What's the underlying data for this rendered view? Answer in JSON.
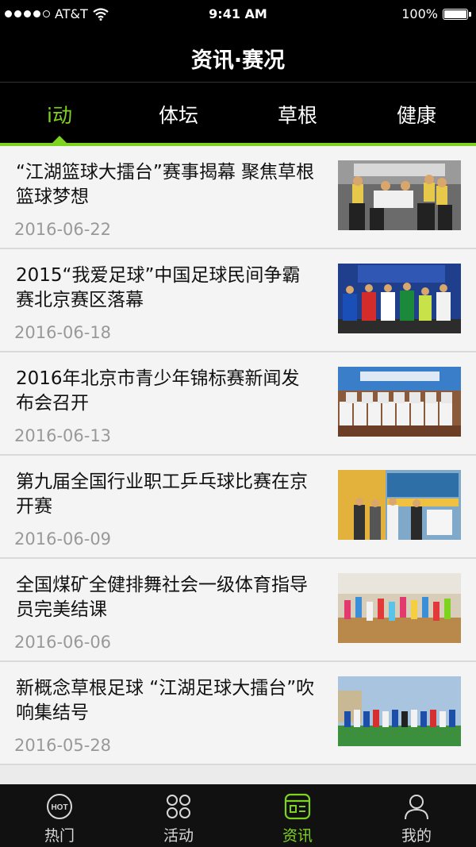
{
  "status_bar": {
    "carrier": "AT&T",
    "time": "9:41 AM",
    "battery": "100%"
  },
  "nav": {
    "title": "资讯·赛况"
  },
  "tabs": [
    {
      "label": "i动"
    },
    {
      "label": "体坛"
    },
    {
      "label": "草根"
    },
    {
      "label": "健康"
    }
  ],
  "news": [
    {
      "title": "“江湖篮球大擂台”赛事揭幕 聚焦草根篮球梦想",
      "date": "2016-06-22"
    },
    {
      "title": "2015“我爱足球”中国足球民间争霸赛北京赛区落幕",
      "date": "2016-06-18"
    },
    {
      "title": "2016年北京市青少年锦标赛新闻发布会召开",
      "date": "2016-06-13"
    },
    {
      "title": "第九届全国行业职工乒乓球比赛在京开赛",
      "date": "2016-06-09"
    },
    {
      "title": "全国煤矿全健排舞社会一级体育指导员完美结课",
      "date": "2016-06-06"
    },
    {
      "title": "新概念草根足球 “江湖足球大擂台”吹响集结号",
      "date": "2016-05-28"
    }
  ],
  "tabbar": [
    {
      "label": "热门",
      "icon": "hot-icon"
    },
    {
      "label": "活动",
      "icon": "activity-icon"
    },
    {
      "label": "资讯",
      "icon": "news-icon"
    },
    {
      "label": "我的",
      "icon": "profile-icon"
    }
  ],
  "colors": {
    "accent": "#7ed321",
    "bar_background": "#000000",
    "list_background": "#f4f4f4"
  }
}
